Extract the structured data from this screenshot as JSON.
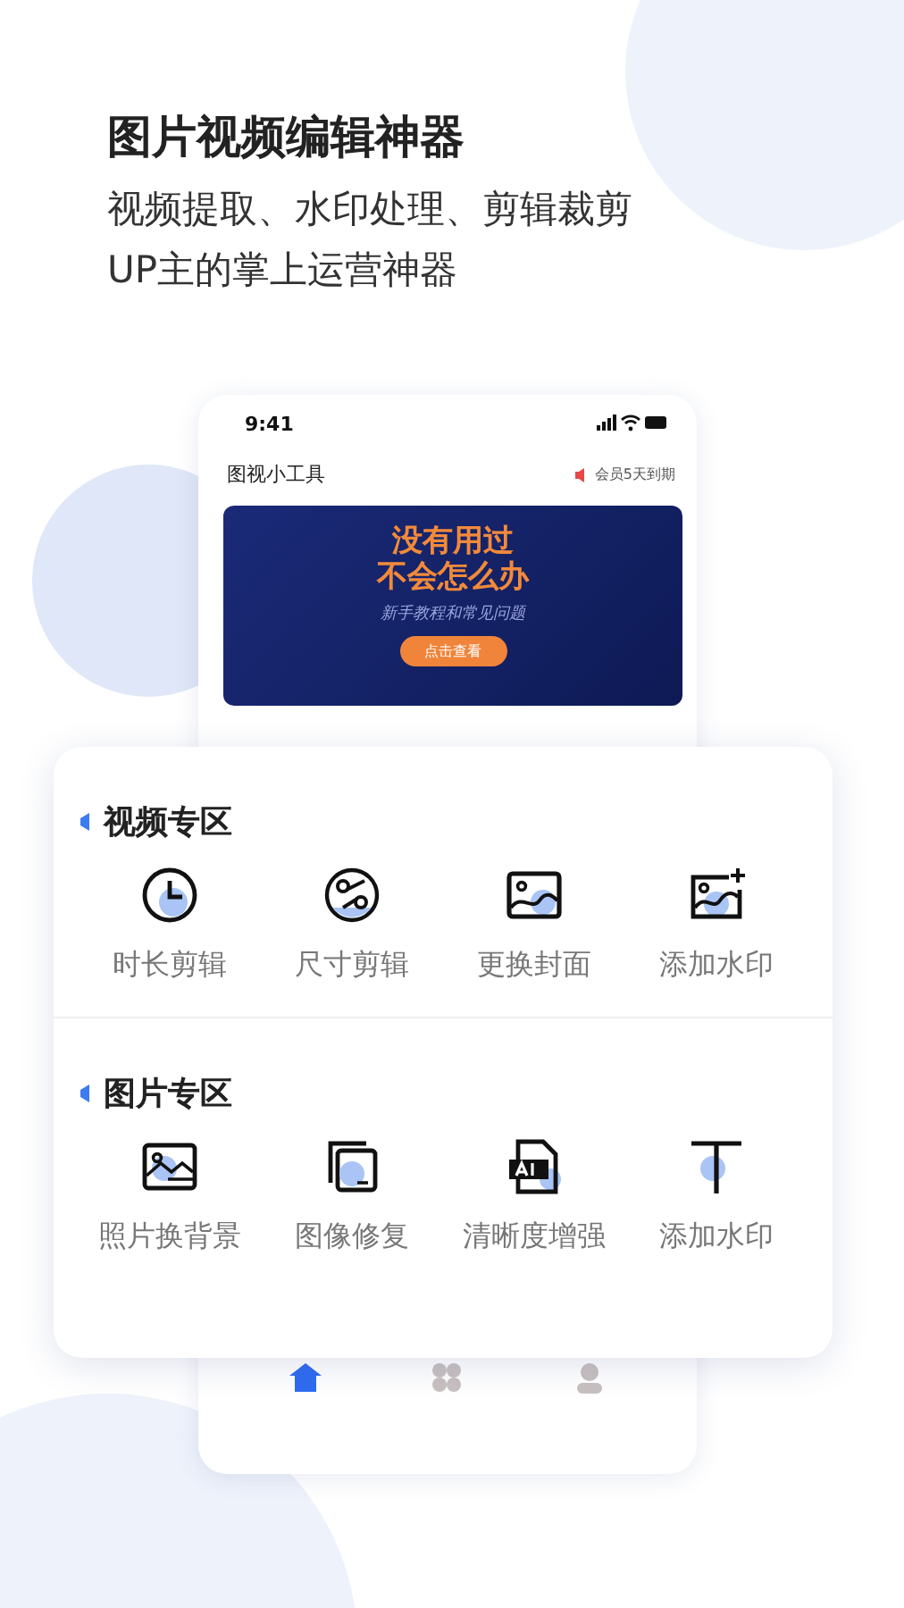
{
  "headline": {
    "title": "图片视频编辑神器",
    "lines": [
      "视频提取、水印处理、剪辑裁剪",
      "UP主的掌上运营神器"
    ]
  },
  "phone": {
    "status_time": "9:41",
    "app_title": "图视小工具",
    "notice": "会员5天到期",
    "banner": {
      "title_lines": [
        "没有用过",
        "不会怎么办"
      ],
      "subtitle": "新手教程和常见问题",
      "button": "点击查看"
    },
    "nav": [
      {
        "kind": "home",
        "selected": true
      },
      {
        "kind": "apps",
        "selected": false
      },
      {
        "kind": "user",
        "selected": false
      }
    ]
  },
  "sections": [
    {
      "title": "视频专区",
      "tools": [
        {
          "kind": "clock",
          "label": "时长剪辑"
        },
        {
          "kind": "scissors",
          "label": "尺寸剪辑"
        },
        {
          "kind": "image",
          "label": "更换封面"
        },
        {
          "kind": "image-add",
          "label": "添加水印"
        }
      ]
    },
    {
      "title": "图片专区",
      "tools": [
        {
          "kind": "landscape",
          "label": "照片换背景"
        },
        {
          "kind": "copy",
          "label": "图像修复"
        },
        {
          "kind": "ai-file",
          "label": "清晰度增强"
        },
        {
          "kind": "text",
          "label": "添加水印"
        }
      ]
    }
  ]
}
